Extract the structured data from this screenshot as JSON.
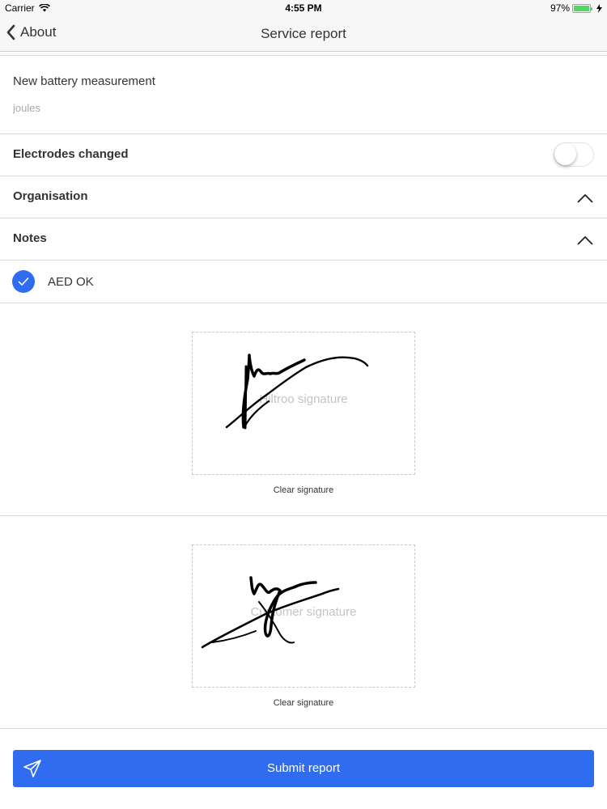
{
  "status_bar": {
    "carrier": "Carrier",
    "time": "4:55 PM",
    "battery": "97%"
  },
  "nav": {
    "back_label": "About",
    "title": "Service report"
  },
  "battery_measurement": {
    "label": "New battery measurement",
    "placeholder": "joules",
    "value": ""
  },
  "electrodes": {
    "label": "Electrodes changed",
    "on": false
  },
  "organisation": {
    "label": "Organisation"
  },
  "notes": {
    "label": "Notes"
  },
  "aed_ok": {
    "label": "AED OK",
    "checked": true
  },
  "signatures": [
    {
      "placeholder": "Hiltroo signature",
      "clear_label": "Clear signature"
    },
    {
      "placeholder": "Customer signature",
      "clear_label": "Clear signature"
    }
  ],
  "submit": {
    "label": "Submit report"
  },
  "colors": {
    "accent": "#2f6cf0",
    "battery_green": "#4cd964",
    "divider": "#dcdcdc"
  }
}
